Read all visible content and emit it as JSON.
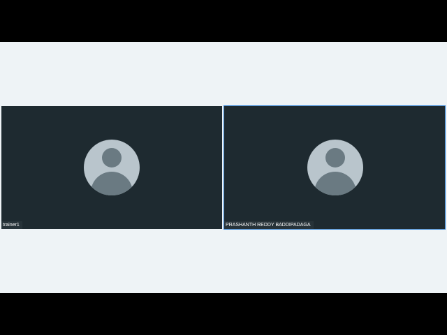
{
  "participants": [
    {
      "name": "trainer1",
      "active_speaker": false
    },
    {
      "name": "PRASHANTH REDDY BADDIPADAGA",
      "active_speaker": true
    }
  ],
  "colors": {
    "background": "#eef3f6",
    "tile": "#1e2a30",
    "active_border": "#2d7fd3",
    "avatar_bg": "#b9c5cc",
    "avatar_fg": "#6a7a82"
  }
}
